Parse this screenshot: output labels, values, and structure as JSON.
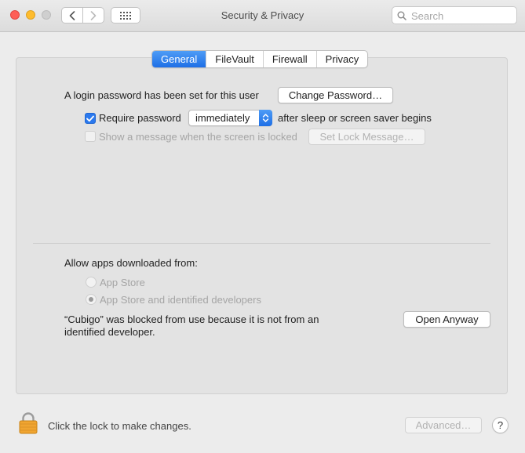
{
  "window": {
    "title": "Security & Privacy",
    "search_placeholder": "Search"
  },
  "tabs": [
    {
      "label": "General",
      "active": true
    },
    {
      "label": "FileVault",
      "active": false
    },
    {
      "label": "Firewall",
      "active": false
    },
    {
      "label": "Privacy",
      "active": false
    }
  ],
  "general": {
    "login_password_text": "A login password has been set for this user",
    "change_password_label": "Change Password…",
    "require_password": {
      "checked": true,
      "label": "Require password",
      "selected": "immediately",
      "suffix": "after sleep or screen saver begins"
    },
    "show_message": {
      "checked": false,
      "enabled": false,
      "label": "Show a message when the screen is locked",
      "button_label": "Set Lock Message…"
    }
  },
  "apps": {
    "heading": "Allow apps downloaded from:",
    "options": [
      {
        "label": "App Store",
        "selected": false
      },
      {
        "label": "App Store and identified developers",
        "selected": true
      }
    ],
    "blocked_line1": "“Cubigo” was blocked from use because it is not from an",
    "blocked_line2": "identified developer.",
    "open_anyway_label": "Open Anyway"
  },
  "footer": {
    "lock_text": "Click the lock to make changes.",
    "advanced_label": "Advanced…",
    "help_label": "?"
  },
  "colors": {
    "accent": "#2b79ee",
    "close": "#fe5f57",
    "minimize": "#febc2e",
    "lock": "#f0a531"
  },
  "icons": [
    "chevron-left-icon",
    "chevron-right-icon",
    "grid-icon",
    "search-icon",
    "checkmark-icon",
    "up-down-arrows-icon",
    "lock-icon",
    "help-icon"
  ]
}
